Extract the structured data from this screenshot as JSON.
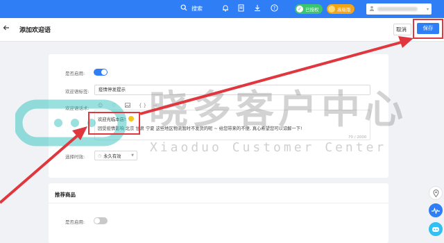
{
  "topbar": {
    "search_label": "搜索",
    "badge_authorized": "已授权",
    "badge_tier": "高级版",
    "icons": [
      "search-icon",
      "bell-icon",
      "document-icon",
      "download-icon",
      "help-icon",
      "user-icon"
    ]
  },
  "header": {
    "back_icon": "arrow-left-icon",
    "title": "添加欢迎语",
    "cancel_label": "取消",
    "save_label": "保存"
  },
  "form": {
    "enabled_label": "是否启用:",
    "enabled": true,
    "tag_label": "欢迎语标签:",
    "tag_value": "疫情停发提示",
    "script_label": "欢迎语话术:",
    "toolbar_icons": [
      "emoji-icon",
      "heart-icon",
      "image-icon",
      "braces-icon",
      "more-icon"
    ],
    "toolbar_braces": "{ }",
    "line1": "欢迎光临本店!",
    "line2": "因受疫情影响 北京 甘肃 宁夏 这些地区物流暂时不发货的呢 ~ 给您带来的不便, 真心希望您可以谅解一下!",
    "char_count": "70 / 2000",
    "time_label": "选择时效:",
    "time_value": "永久有效"
  },
  "recommend": {
    "title": "推荐商品",
    "enabled_label": "是否启用:",
    "enabled": false
  },
  "watermark": {
    "cn": "晓多客户中心",
    "en": "Xiaoduo Customer Center"
  },
  "colors": {
    "primary": "#2f7ef5",
    "highlight": "#e0373f",
    "authorized": "#3cc46f",
    "tier": "#f3a417"
  }
}
